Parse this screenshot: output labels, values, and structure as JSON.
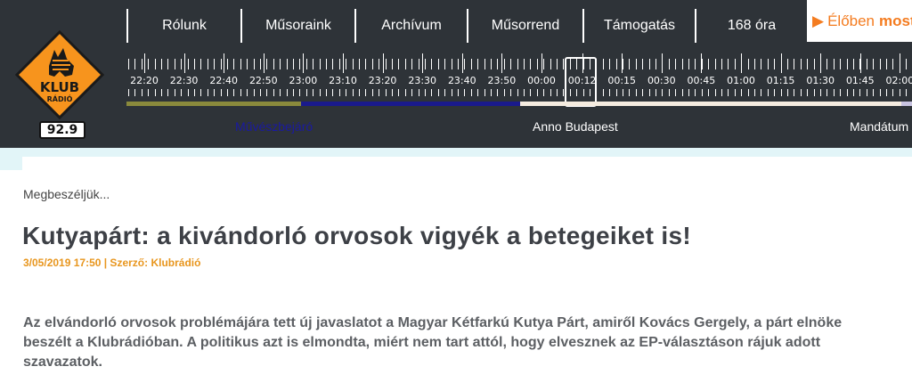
{
  "logo": {
    "brand": "KLUB",
    "sub": "RÁDIÓ",
    "frequency": "92.9"
  },
  "nav": [
    {
      "label": "Rólunk",
      "width": 128
    },
    {
      "label": "Műsoraink",
      "width": 128
    },
    {
      "label": "Archívum",
      "width": 126
    },
    {
      "label": "Műsorrend",
      "width": 130
    },
    {
      "label": "Támogatás",
      "width": 126
    },
    {
      "label": "168 óra",
      "width": 126
    }
  ],
  "live": {
    "arrow": "▶",
    "label": "Élőben",
    "label_bold": "most"
  },
  "timeline": {
    "labels": [
      "22:20",
      "22:30",
      "22:40",
      "22:50",
      "23:00",
      "23:10",
      "23:20",
      "23:30",
      "23:40",
      "23:50",
      "00:00",
      "00:12",
      "00:15",
      "00:30",
      "00:45",
      "01:00",
      "01:15",
      "01:30",
      "01:45",
      "02:00"
    ],
    "current": "00:12",
    "programs": [
      {
        "name": "Művészbejáró",
        "color": "#1a1aa0"
      },
      {
        "name": "Anno Budapest",
        "color": "#ffffff"
      },
      {
        "name": "Mandátum",
        "color": "#ffffff"
      }
    ],
    "bar_colors": [
      "#8a8a3c",
      "#1a1a8c",
      "#f5ece0",
      "#c8c3e0"
    ]
  },
  "article": {
    "breadcrumb": "Megbeszéljük...",
    "title": "Kutyapárt: a kivándorló orvosok vigyék a betegeiket is!",
    "meta": "3/05/2019 17:50 | Szerző: Klubrádió",
    "lead": "Az elvándorló orvosok problémájára tett új javaslatot a Magyar Kétfarkú Kutya Párt, amiről Kovács Gergely, a párt elnöke beszélt a Klubrádióban. A politikus azt is elmondta, miért nem tart attól, hogy elvesznek az EP-választáson rájuk adott szavazatok."
  }
}
